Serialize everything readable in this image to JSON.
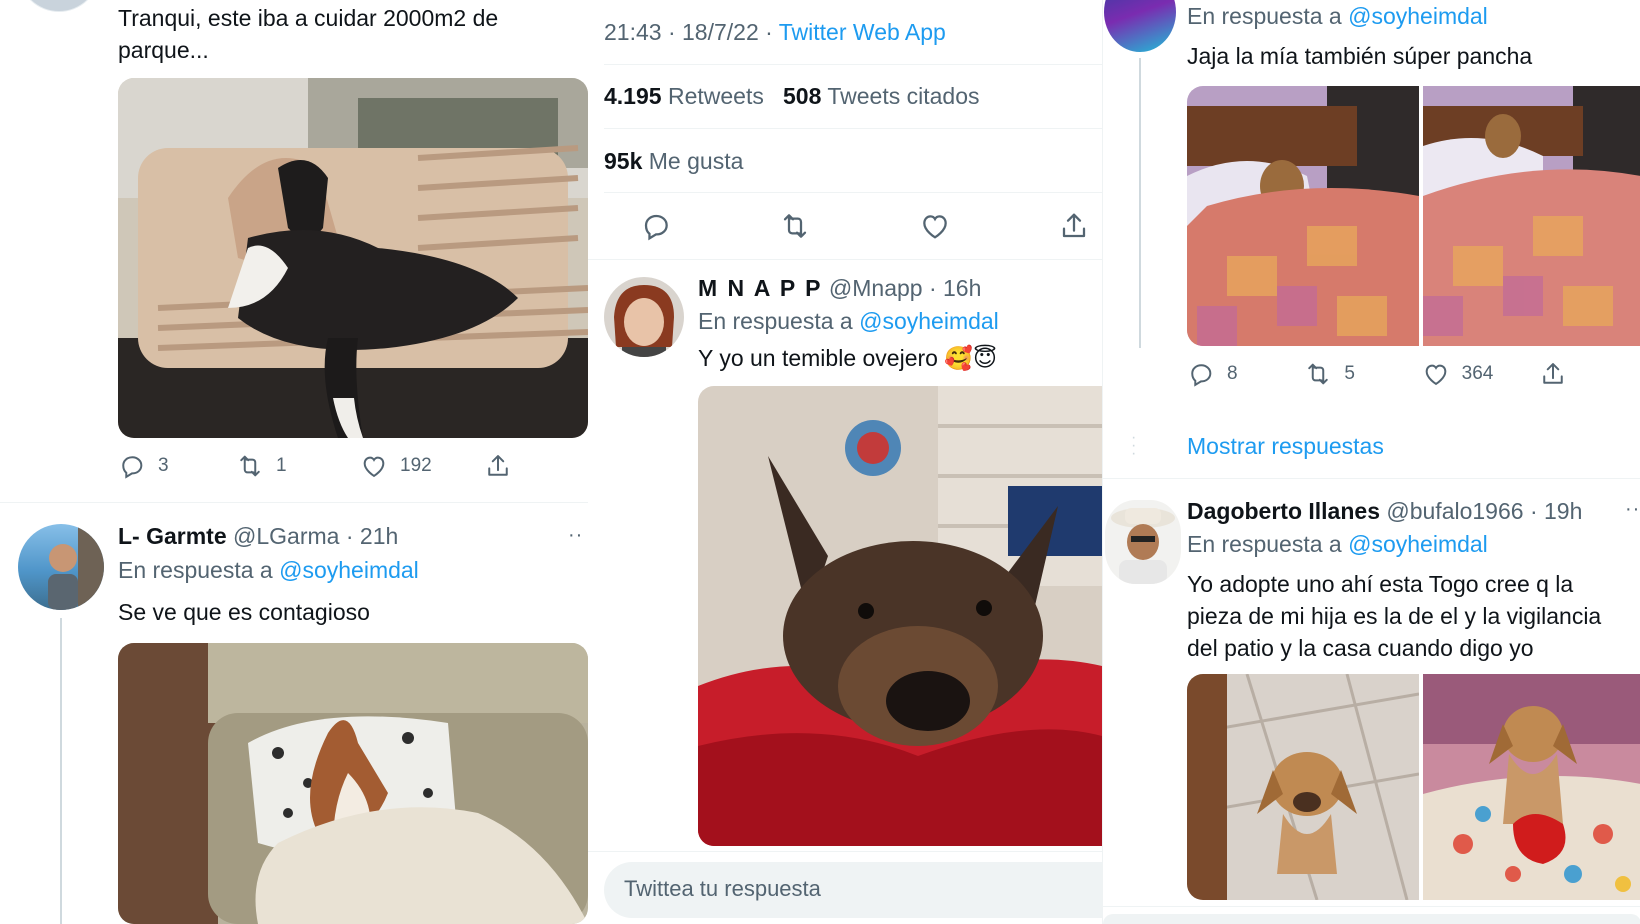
{
  "left_column": {
    "top_tweet": {
      "text_line1": "Tranqui, este iba a cuidar 2000m2 de",
      "text_line2": "parque...",
      "replies": "3",
      "retweets": "1",
      "likes": "192"
    },
    "reply": {
      "name": "L- Garmte",
      "handle": "@LGarma",
      "time": "· 21h",
      "reply_prefix": "En respuesta a",
      "reply_to": "@soyheimdal",
      "text": "Se ve que es contagioso",
      "more": "··"
    }
  },
  "middle_column": {
    "timestamp": "21:43 · 18/7/22 ·",
    "source": "Twitter Web App",
    "retweets_count": "4.195",
    "retweets_label": "Retweets",
    "quotes_count": "508",
    "quotes_label": "Tweets citados",
    "likes_count": "95k",
    "likes_label": "Me gusta",
    "reply": {
      "name": "M N A P P",
      "handle": "@Mnapp",
      "time": "· 16h",
      "reply_prefix": "En respuesta a",
      "reply_to": "@soyheimdal",
      "text": "Y yo un temible ovejero",
      "emoji": "🥰😇"
    },
    "reply_box_placeholder": "Twittea tu respuesta"
  },
  "right_column": {
    "top_reply": {
      "reply_prefix": "En respuesta a",
      "reply_to": "@soyheimdal",
      "text": "Jaja la mía también súper pancha",
      "replies": "8",
      "retweets": "5",
      "likes": "364"
    },
    "show_replies": "Mostrar respuestas",
    "reply": {
      "name": "Dagoberto Illanes",
      "handle": "@bufalo1966",
      "time": "· 19h",
      "more": "··",
      "reply_prefix": "En respuesta a",
      "reply_to": "@soyheimdal",
      "text_line1": "Yo adopte uno ahí esta Togo cree q la",
      "text_line2": "pieza de mi hija es la de el y la vigilancia",
      "text_line3": "del patio y la casa cuando digo yo"
    }
  },
  "colors": {
    "accent": "#1d9bf0",
    "text": "#0f1419",
    "muted": "#536471",
    "divider": "#eff3f4"
  }
}
